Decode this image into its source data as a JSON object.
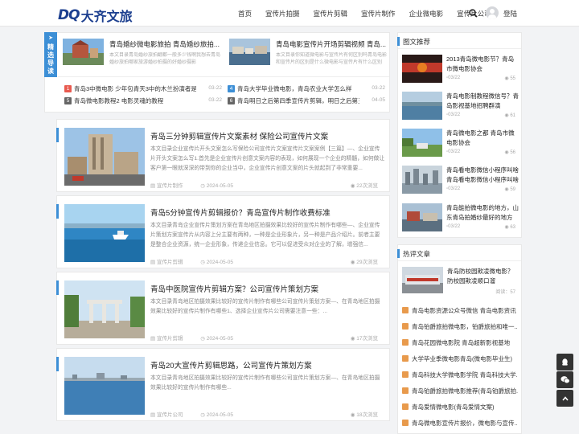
{
  "header": {
    "logo_mark": "DQ",
    "logo_text": "大齐文旅",
    "nav": [
      "首页",
      "宣传片拍摄",
      "宣传片剪辑",
      "宣传片制作",
      "企业微电影",
      "宣传片公司"
    ],
    "login": "登陆"
  },
  "featured": {
    "tab_label": [
      "精",
      "选",
      "导",
      "读"
    ],
    "cards": [
      {
        "title": "青岛婚纱微电影旅拍 青岛婚纱旅拍...",
        "desc": "本文目录青岛婚纱旅拍翻都一般多少钱啊我想去青岛婚纱旅拍哪家旅游婚纱拍摄的好婚纱摄影"
      },
      {
        "title": "青岛电影宣传片开场剪辑视频 青岛...",
        "desc": "本文目录你知道微电影与宣传片有何区别吗青岛电影和宣传片的区别是什么微电影与宣传片有什么区别"
      }
    ],
    "list": [
      {
        "num": "1",
        "title": "青岛3中微电影 少年包青天3中的木兰扮演者是谁",
        "date": "03-22",
        "color": "#e85a4f"
      },
      {
        "num": "4",
        "title": "青岛大学毕业微电影，青岛农业大学怎么样",
        "date": "03-22",
        "color": "#3d8fd6"
      },
      {
        "num": "5",
        "title": "青岛微电影教程2 电影灵魂的教程",
        "date": "03-22",
        "color": "#666666"
      },
      {
        "num": "6",
        "title": "青岛明日之后第四季宣传片剪辑，明日之后第三...",
        "date": "04-05",
        "color": "#666666"
      }
    ]
  },
  "articles": [
    {
      "title": "青岛三分钟剪辑宣传片文案素材 保险公司宣传片文案",
      "desc": "本文目录企业宣传片开头文案怎么写保险公司宣传片文案宣传片文案案例【三篇】—、企业宣传片开头文案怎么写1.首先是企业宣传片创意文案内容的表现，如何展现一个企业的精髓，如何做让客户第一眼就深深的带到你的企业当中，企业宣传片创意文案的片头就起到了非常重要...",
      "category": "宣传片制作",
      "date": "2024-05-05",
      "views": "22次浏览"
    },
    {
      "title": "青岛5分钟宣传片剪辑报价？青岛宣传片制作收费标准",
      "desc": "本文目录青岛企业宣传片策划方案在青岛地区拍摄效果比较好的宣传片制作有哪些—、企业宣传片策划方案宣传片从内容上分主要有两种，一种是企业形象片，另一种是产品介绍片。前者主要是整合企业资源，统一企业形象，传递企业信息。它可以促进受众对企业的了解，增强信...",
      "category": "宣传片剪辑",
      "date": "2024-05-05",
      "views": "29次浏览"
    },
    {
      "title": "青岛中医院宣传片剪辑方案？公司宣传片策划方案",
      "desc": "本文目录青岛地区拍摄效果比较好的宣传片制作有哪些公司宣传片策划方案—、在青岛地区拍摄效果比较好的宣传片制作有哪些1、选择企业宣传片公司需要注意一些：...",
      "category": "宣传片剪辑",
      "date": "2024-05-05",
      "views": "17次浏览"
    },
    {
      "title": "青岛20大宣传片剪辑思路，公司宣传片策划方案",
      "desc": "本文目录青岛地区拍摄效果比较好的宣传片制作有哪些公司宣传片策划方案—、在青岛地区拍摄效果比较好的宣传片制作有哪些...",
      "category": "宣传片公司",
      "date": "2024-05-05",
      "views": "18次浏览"
    }
  ],
  "sidebar": {
    "recommend_title": "图文推荐",
    "recommend": [
      {
        "title": "2013青岛微电影节？青岛市微电影协会",
        "date": "03/22",
        "views": "55"
      },
      {
        "title": "青岛电影制教程微信号？青岛影视基地招聘群演",
        "date": "03/22",
        "views": "61"
      },
      {
        "title": "青岛微电影之都 青岛市微电影协会",
        "date": "03/22",
        "views": "56"
      },
      {
        "title": "青岛看电影微信小程序叫啥 青岛看电影微信小程序叫啥",
        "date": "03/22",
        "views": "59"
      },
      {
        "title": "青岛能拍微电影的地方，山东青岛拍婚纱最好的地方",
        "date": "03/22",
        "views": "63"
      }
    ],
    "hot_title": "热评文章",
    "hot_top": {
      "title": "青岛防校园欺凌微电影？防校园欺凌顺口溜",
      "views": "阅读：57"
    },
    "hot": [
      "青岛电影资源公众号微信 青岛电影资讯",
      "青岛铂爵旅拍微电影，铂爵旅拍和唯一...",
      "青岛花园微电影院 青岛超新影视基地",
      "大学毕业季微电影青岛(微电影毕业生)",
      "青岛科技大学微电影学院 青岛科技大学...",
      "青岛铂爵旅拍微电影推荐(青岛铂爵旅拍...",
      "青岛爱情微电影(青岛爱情文案)",
      "青岛微电影宣传片报价，微电影与宣传..."
    ]
  }
}
